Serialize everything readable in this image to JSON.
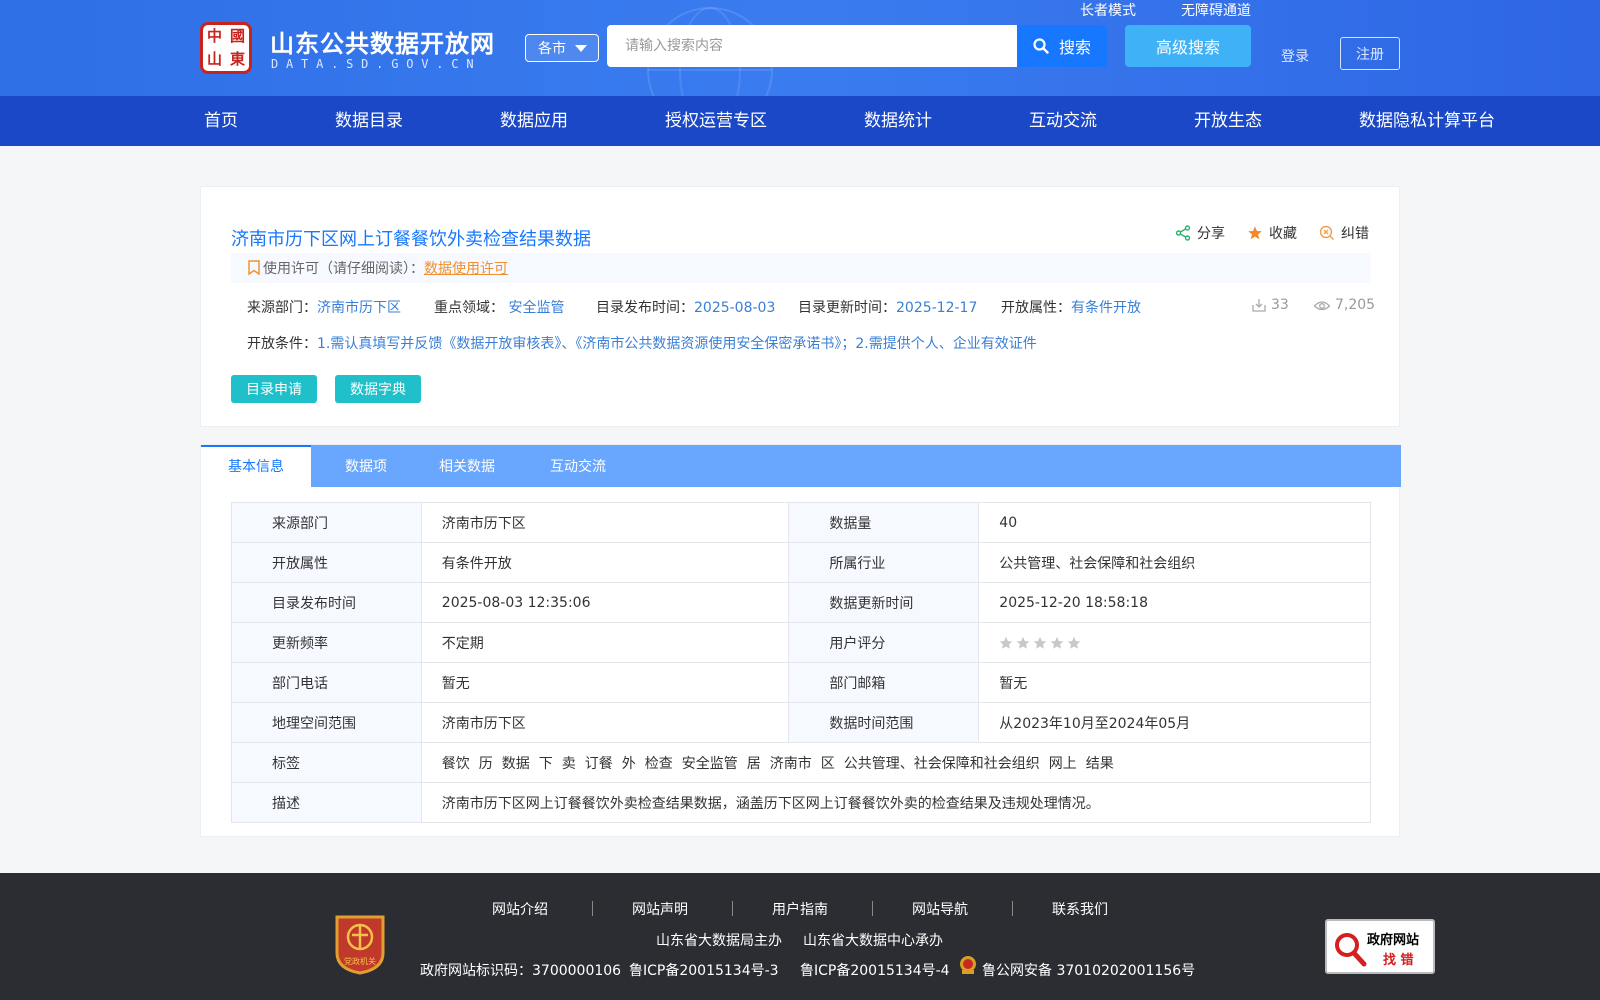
{
  "header": {
    "logo_seal": [
      "中",
      "國",
      "山",
      "東"
    ],
    "title": "山东公共数据开放网",
    "subtitle": "DATA.SD.GOV.CN",
    "top_links": [
      "长者模式",
      "无障碍通道"
    ],
    "city_select": "各市",
    "search_placeholder": "请输入搜索内容",
    "search_label": "搜索",
    "advanced_search_label": "高级搜索",
    "login_label": "登录",
    "register_label": "注册"
  },
  "nav": [
    "首页",
    "数据目录",
    "数据应用",
    "授权运营专区",
    "数据统计",
    "互动交流",
    "开放生态",
    "数据隐私计算平台"
  ],
  "dataset": {
    "title": "济南市历下区网上订餐餐饮外卖检查结果数据",
    "actions": [
      "分享",
      "收藏",
      "纠错"
    ],
    "license_prefix": "使用许可（请仔细阅读）：",
    "license_link": "数据使用许可",
    "meta": {
      "source_label": "来源部门：",
      "source_value": "济南市历下区",
      "domain_label": "重点领域：",
      "domain_value": "安全监管",
      "publish_label": "目录发布时间：",
      "publish_value": "2025-08-03",
      "update_label": "目录更新时间：",
      "update_value": "2025-12-17",
      "open_label": "开放属性：",
      "open_value": "有条件开放",
      "downloads": "33",
      "views": "7,205"
    },
    "condition_label": "开放条件：",
    "condition_value": "1.需认真填写并反馈《数据开放审核表》、《济南市公共数据资源使用安全保密承诺书》；2.需提供个人、企业有效证件",
    "buttons": [
      "目录申请",
      "数据字典"
    ]
  },
  "tabs": [
    "基本信息",
    "数据项",
    "相关数据",
    "互动交流"
  ],
  "info_rows": [
    {
      "l1": "来源部门",
      "v1": "济南市历下区",
      "l2": "数据量",
      "v2": "40"
    },
    {
      "l1": "开放属性",
      "v1": "有条件开放",
      "l2": "所属行业",
      "v2": "公共管理、社会保障和社会组织"
    },
    {
      "l1": "目录发布时间",
      "v1": "2025-08-03 12:35:06",
      "l2": "数据更新时间",
      "v2": "2025-12-20 18:58:18"
    },
    {
      "l1": "更新频率",
      "v1": "不定期",
      "l2": "用户评分",
      "v2": ""
    },
    {
      "l1": "部门电话",
      "v1": "暂无",
      "l2": "部门邮箱",
      "v2": "暂无"
    },
    {
      "l1": "地理空间范围",
      "v1": "济南市历下区",
      "l2": "数据时间范围",
      "v2": "从2023年10月至2024年05月"
    }
  ],
  "user_rating": {
    "value": 0,
    "max": 5
  },
  "tags_label": "标签",
  "tags": [
    "餐饮",
    "历",
    "数据",
    "下",
    "卖",
    "订餐",
    "外",
    "检查",
    "安全监管",
    "居",
    "济南市",
    "区",
    "公共管理、社会保障和社会组织",
    "网上",
    "结果"
  ],
  "description_label": "描述",
  "description": "济南市历下区网上订餐餐饮外卖检查结果数据，涵盖历下区网上订餐餐饮外卖的检查结果及违规处理情况。",
  "footer": {
    "links": [
      "网站介绍",
      "网站声明",
      "用户指南",
      "网站导航",
      "联系我们"
    ],
    "sponsor": "山东省大数据局主办",
    "organizer": "山东省大数据中心承办",
    "gov_id": "政府网站标识码：3700000106",
    "icp1": "鲁ICP备20015134号-3",
    "icp2": "鲁ICP备20015134号-4",
    "police": "鲁公网安备 37010202001156号",
    "party_badge": "党政机关",
    "gov_badge_top": "政府网站",
    "gov_badge_bottom": "找 错"
  },
  "colors": {
    "header_blue": "#2f6fe6",
    "nav_blue": "#1b48c7",
    "link_blue": "#1778ff",
    "tab_blue": "#69a7ff",
    "teal": "#1fc0c9",
    "orange": "#f0902d",
    "footer_bg": "#2b2d33"
  }
}
